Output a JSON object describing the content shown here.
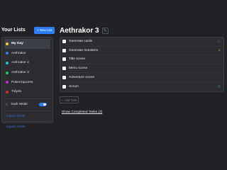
{
  "sidebar": {
    "title": "Your Lists",
    "new_list_label": "+ New List",
    "items": [
      {
        "label": "My Day",
        "color": "#f2c94c",
        "active": true
      },
      {
        "label": "Aethrakor",
        "color": "#3b82f6",
        "active": false
      },
      {
        "label": "Aethrakor 2",
        "color": "#22c1dc",
        "active": false
      },
      {
        "label": "Aethrakor 3",
        "color": "#22c55e",
        "active": false
      },
      {
        "label": "PokerSquares",
        "color": "#c026d3",
        "active": false
      },
      {
        "label": "Tidydo",
        "color": "#dc2626",
        "active": false
      }
    ],
    "dark_mode": {
      "label": "Dark Mode",
      "icon": "moon-icon",
      "on": true
    },
    "import_label": "Import JSON",
    "export_label": "Export JSON"
  },
  "main": {
    "title": "Aethrakor 3",
    "tasks": [
      {
        "label": "Generate cards",
        "icon": "calendar-icon",
        "glyph": "▭",
        "color": "#e05252"
      },
      {
        "label": "Generate monsters",
        "icon": "bell-icon",
        "glyph": "♫",
        "color": "#e0a93b"
      },
      {
        "label": "Title scene",
        "icon": "",
        "glyph": "",
        "color": ""
      },
      {
        "label": "Menu scene",
        "icon": "",
        "glyph": "",
        "color": ""
      },
      {
        "label": "Adventure scene",
        "icon": "",
        "glyph": "",
        "color": ""
      },
      {
        "label": "Scrum",
        "icon": "recurring-icon",
        "glyph": "◇",
        "color": "#2ecc9a"
      }
    ],
    "add_task_label": "+ Add Task",
    "show_completed_label": "Show Completed Tasks (3)"
  }
}
